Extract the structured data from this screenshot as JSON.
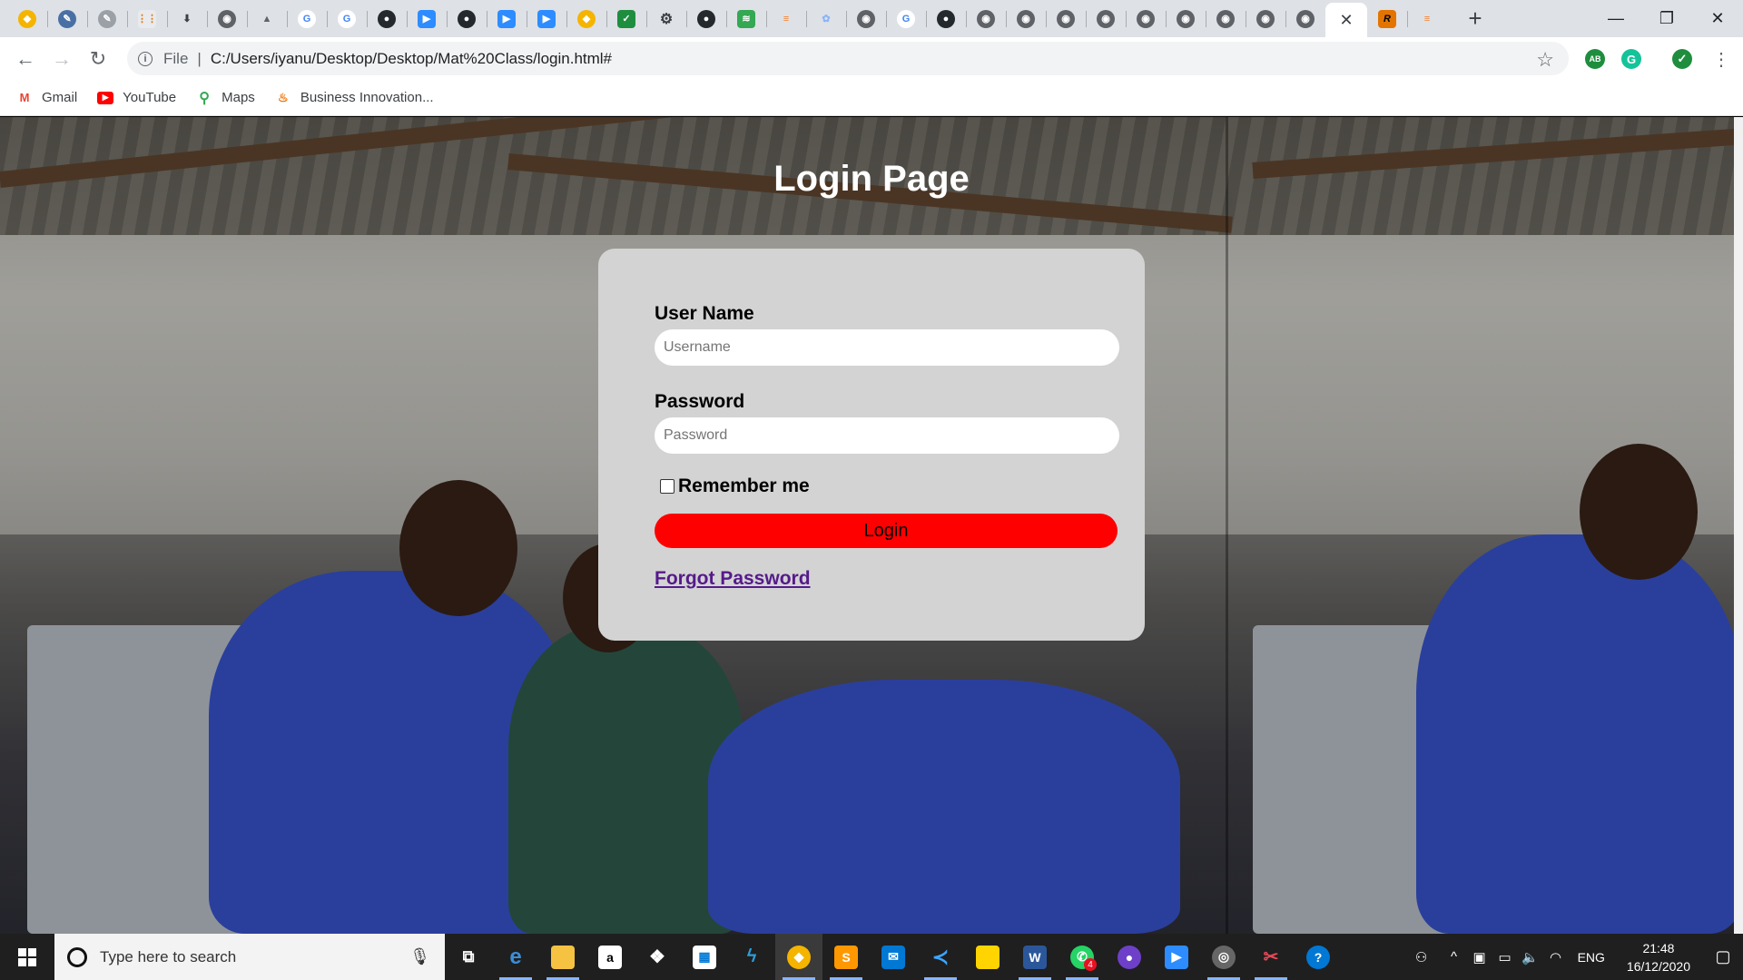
{
  "browser": {
    "active_tab_close": "✕",
    "new_tab": "+",
    "window_controls": {
      "minimize": "—",
      "maximize": "❐",
      "close": "✕"
    },
    "address": {
      "scheme": "File",
      "separator": "|",
      "url": "C:/Users/iyanu/Desktop/Desktop/Mat%20Class/login.html#"
    },
    "bookmarks": [
      {
        "label": "Gmail",
        "icon": "gmail-icon"
      },
      {
        "label": "YouTube",
        "icon": "youtube-icon"
      },
      {
        "label": "Maps",
        "icon": "maps-icon"
      },
      {
        "label": "Business Innovation...",
        "icon": "java-icon"
      }
    ],
    "extensions": [
      "adblock-icon",
      "grammarly-icon",
      "shield-extension-icon"
    ]
  },
  "page": {
    "title": "Login Page",
    "username_label": "User Name",
    "username_placeholder": "Username",
    "password_label": "Password",
    "password_placeholder": "Password",
    "remember_label": "Remember me",
    "login_button": "Login",
    "forgot_link": "Forgot Password"
  },
  "taskbar": {
    "search_placeholder": "Type here to search",
    "language": "ENG",
    "time": "21:48",
    "date": "16/12/2020",
    "whatsapp_badge": "4"
  },
  "colors": {
    "login_button": "#ff0000",
    "card_background": "#d3d3d3",
    "link": "#551a8b",
    "taskbar": "#1f1f1f"
  }
}
